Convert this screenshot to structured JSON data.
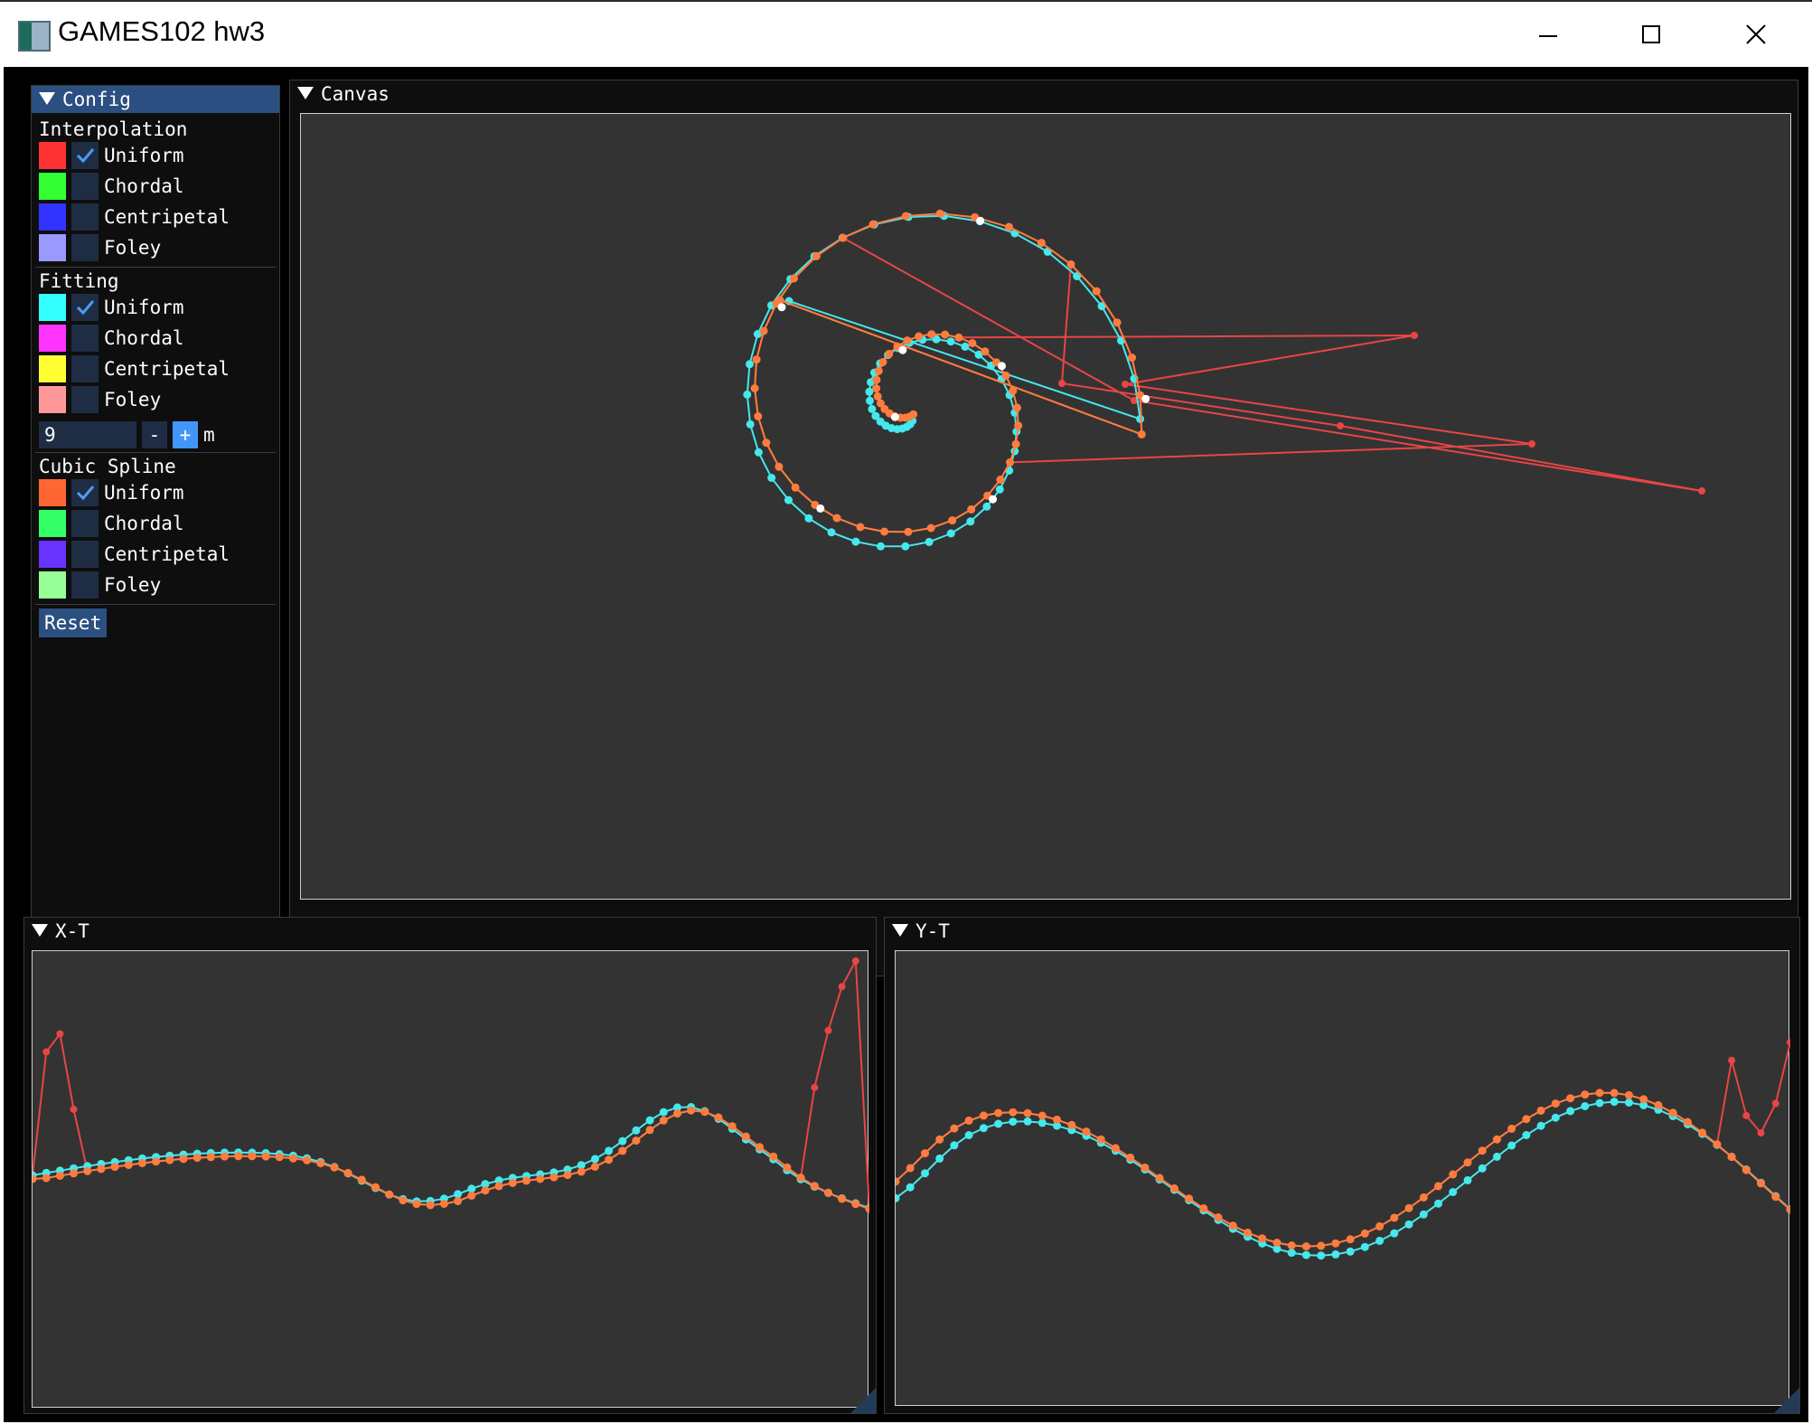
{
  "window": {
    "title": "GAMES102 hw3"
  },
  "colors": {
    "accent": "#2b4f80",
    "button_blue": "#4296fa",
    "check_mark": "#4b9cf5",
    "curve_interp_uniform": "#e84545",
    "curve_fit_uniform": "#45e8ec",
    "curve_spline_uniform": "#ff7c3f",
    "input_point": "#ffffff"
  },
  "config": {
    "title": "Config",
    "interpolation": {
      "label": "Interpolation",
      "items": [
        {
          "label": "Uniform",
          "color": "#ff3333",
          "checked": true
        },
        {
          "label": "Chordal",
          "color": "#33ff33",
          "checked": false
        },
        {
          "label": "Centripetal",
          "color": "#3333ff",
          "checked": false
        },
        {
          "label": "Foley",
          "color": "#9999ff",
          "checked": false
        }
      ]
    },
    "fitting": {
      "label": "Fitting",
      "items": [
        {
          "label": "Uniform",
          "color": "#33ffff",
          "checked": true
        },
        {
          "label": "Chordal",
          "color": "#ff33ff",
          "checked": false
        },
        {
          "label": "Centripetal",
          "color": "#ffff33",
          "checked": false
        },
        {
          "label": "Foley",
          "color": "#ff9999",
          "checked": false
        }
      ],
      "m_value": "9",
      "minus": "-",
      "plus": "+",
      "m_label": "m"
    },
    "cubic_spline": {
      "label": "Cubic Spline",
      "items": [
        {
          "label": "Uniform",
          "color": "#ff6633",
          "checked": true
        },
        {
          "label": "Chordal",
          "color": "#33ff66",
          "checked": false
        },
        {
          "label": "Centripetal",
          "color": "#6633ff",
          "checked": false
        },
        {
          "label": "Foley",
          "color": "#99ff99",
          "checked": false
        }
      ]
    },
    "reset_label": "Reset"
  },
  "canvas": {
    "title": "Canvas"
  },
  "xt": {
    "title": "X-T"
  },
  "yt": {
    "title": "Y-T"
  }
}
